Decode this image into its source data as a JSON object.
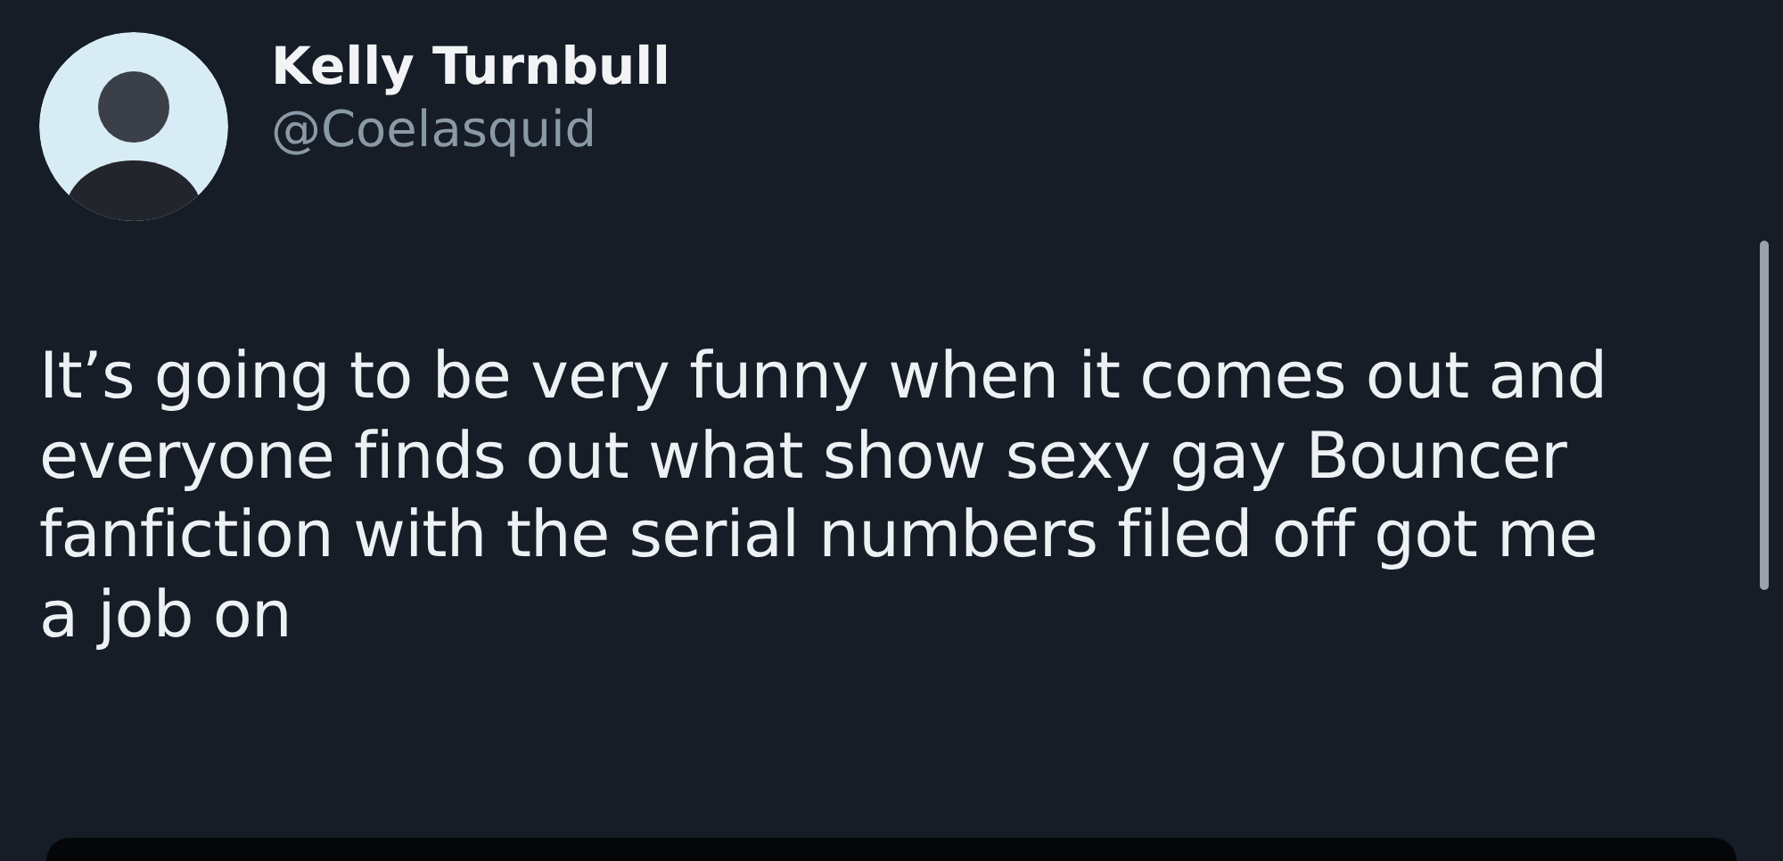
{
  "author": {
    "name": "Kelly Turnbull",
    "handle": "@Coelasquid"
  },
  "post": {
    "text_lines": [
      "It’s going to be very funny when it comes out and",
      "everyone finds out what show sexy gay Bouncer",
      "fanfiction with the serial numbers filed off got me",
      "a job on"
    ]
  }
}
